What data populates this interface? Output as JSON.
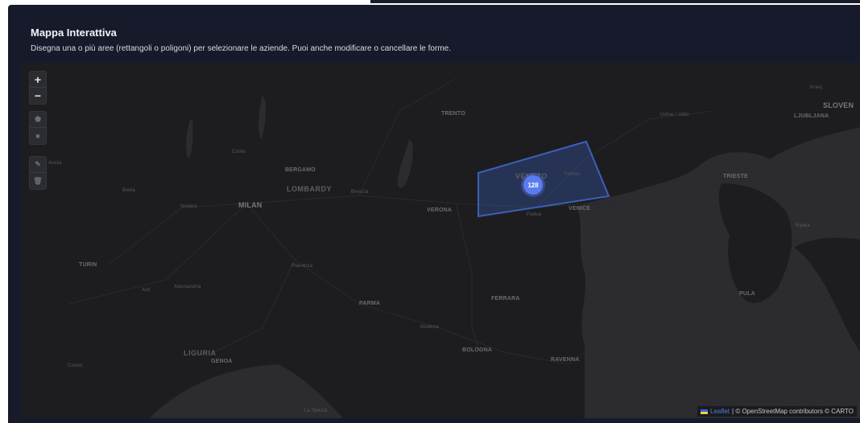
{
  "panel": {
    "title": "Mappa Interattiva",
    "description": "Disegna una o più aree (rettangoli o poligoni) per selezionare le aziende. Puoi anche modificare o cancellare le forme."
  },
  "zoom": {
    "in_label": "+",
    "out_label": "−"
  },
  "draw_tools": {
    "polygon_icon": "polygon-icon",
    "rectangle_icon": "rectangle-icon",
    "edit_icon": "edit-icon",
    "delete_icon": "trash-icon"
  },
  "places": {
    "trento": "TRENTO",
    "udine": "Udine / Udin",
    "slovenia": "SLOVEN",
    "ljubljana": "LJUBLJANA",
    "kranj": "Kranj",
    "como": "Como",
    "bergamo": "BERGAMO",
    "lombardy": "LOMBARDY",
    "brescia": "Brescia",
    "milan": "MILAN",
    "novara": "Novara",
    "biella": "Biella",
    "aosta": "Aosta",
    "verona": "VERONA",
    "veneto": "VENETO",
    "treviso": "Treviso",
    "padua": "Padua",
    "venice": "VENICE",
    "trieste": "TRIESTE",
    "rijeka": "Rijeka",
    "pula": "PULA",
    "turin": "TURIN",
    "asti": "Asti",
    "alessandria": "Alessandria",
    "piacenza": "Piacenza",
    "parma": "PARMA",
    "modena": "Modena",
    "ferrara": "FERRARA",
    "bologna": "BOLOGNA",
    "ravenna": "RAVENNA",
    "liguria": "LIGURIA",
    "genoa": "GENOA",
    "cuneo": "Cuneo",
    "la_spezia": "La Spezia"
  },
  "cluster": {
    "count": "128",
    "color": "#5b7cf0"
  },
  "selection_polygon": {
    "stroke": "#3d5fb8",
    "fill": "#3d5fb8"
  },
  "attribution": {
    "leaflet": "Leaflet",
    "rest": "| © OpenStreetMap contributors © CARTO"
  },
  "colors": {
    "panel_bg": "#161a2b",
    "map_land": "#1d1d20",
    "map_water": "#2e2e32"
  }
}
